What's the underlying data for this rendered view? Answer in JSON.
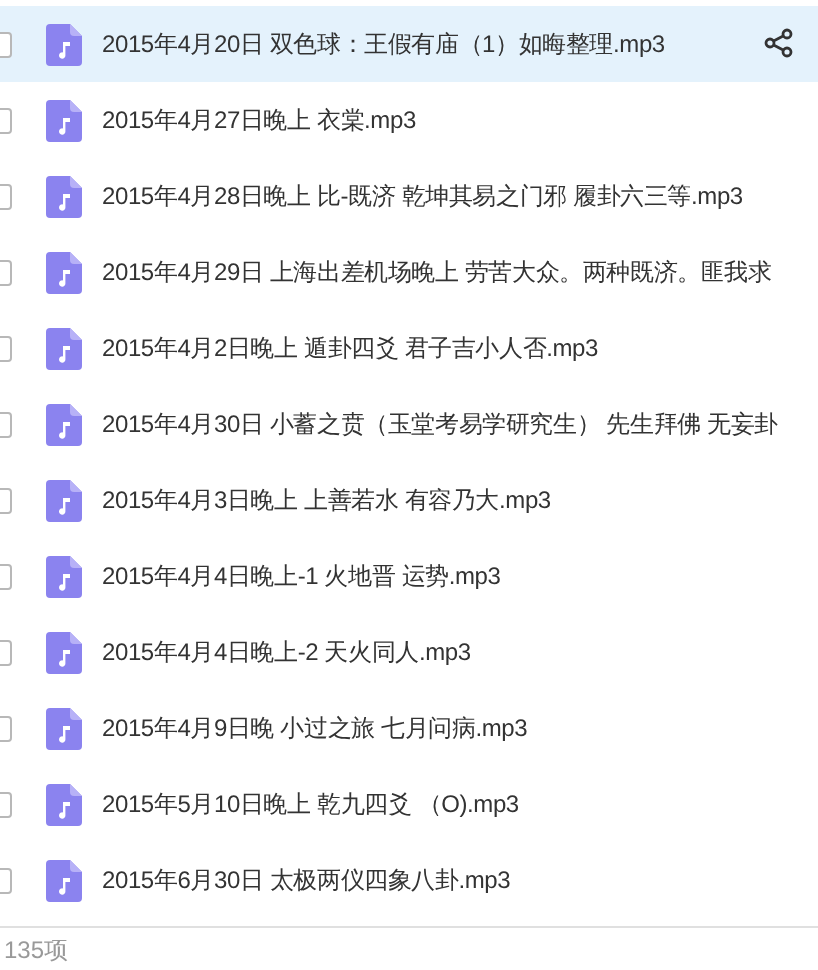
{
  "files": [
    {
      "name": "2015年4月20日 双色球：王假有庙（1）如晦整理.mp3",
      "selected": true,
      "checked": false
    },
    {
      "name": "2015年4月27日晚上 衣棠.mp3",
      "selected": false,
      "checked": false
    },
    {
      "name": "2015年4月28日晚上 比-既济 乾坤其易之门邪  履卦六三等.mp3",
      "selected": false,
      "checked": false
    },
    {
      "name": "2015年4月29日 上海出差机场晚上  劳苦大众。两种既济。匪我求",
      "selected": false,
      "checked": false
    },
    {
      "name": "2015年4月2日晚上 遁卦四爻 君子吉小人否.mp3",
      "selected": false,
      "checked": false
    },
    {
      "name": "2015年4月30日 小蓄之贲（玉堂考易学研究生） 先生拜佛 无妄卦",
      "selected": false,
      "checked": false
    },
    {
      "name": "2015年4月3日晚上 上善若水 有容乃大.mp3",
      "selected": false,
      "checked": false
    },
    {
      "name": "2015年4月4日晚上-1  火地晋 运势.mp3",
      "selected": false,
      "checked": false
    },
    {
      "name": "2015年4月4日晚上-2 天火同人.mp3",
      "selected": false,
      "checked": false
    },
    {
      "name": "2015年4月9日晚 小过之旅 七月问病.mp3",
      "selected": false,
      "checked": false
    },
    {
      "name": "2015年5月10日晚上 乾九四爻  （O).mp3",
      "selected": false,
      "checked": false
    },
    {
      "name": "2015年6月30日 太极两仪四象八卦.mp3",
      "selected": false,
      "checked": false
    }
  ],
  "status_bar": {
    "count": "135项"
  }
}
